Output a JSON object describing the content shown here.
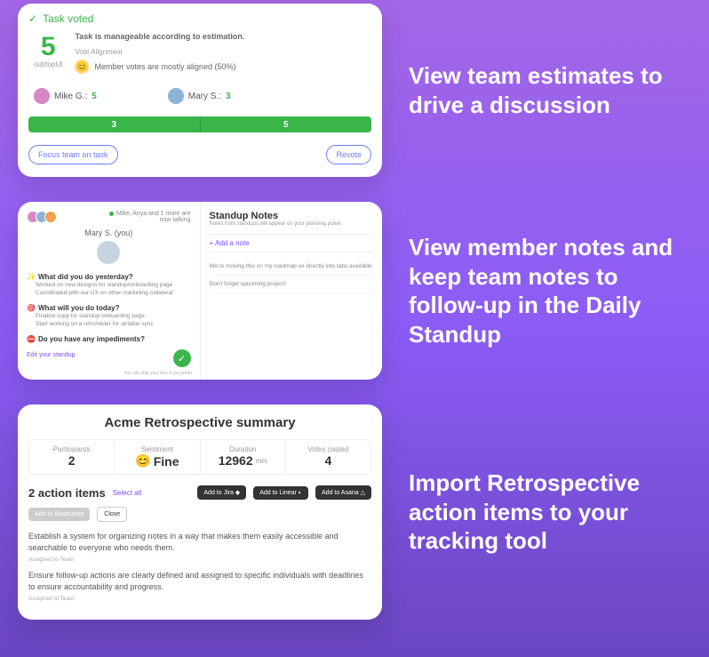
{
  "captions": {
    "c1": "View team estimates to drive a discussion",
    "c2": "View member notes and keep team notes to follow-up in the Daily Standup",
    "c3": "Import Retrospective action items to your tracking tool"
  },
  "card1": {
    "voted": "Task voted",
    "score": "5",
    "scoreLabel": "out/topUt",
    "desc": "Task is manageable according to estimation.",
    "alignLabel": "Vote Alignment",
    "alignText": "Member votes are mostly aligned (50%)",
    "voter1": "Mike G.:",
    "voter1Score": "5",
    "voter2": "Mary S.:",
    "voter2Score": "3",
    "dist1": "3",
    "dist2": "5",
    "focusBtn": "Focus team on task",
    "revoteBtn": "Revote"
  },
  "card2": {
    "status1": "Mike, Anya and 1 more are",
    "status2": "now talking",
    "memberName": "Mary S. (you)",
    "q1": "What did you do yesterday?",
    "q1sub1": "Worked on new designs for standup/onboarding page",
    "q1sub2": "Coordinated with our UX on other marketing collateral",
    "q2": "What will you do today?",
    "q2sub1": "Finalize copy for standup onboarding page",
    "q2sub2": "Start working on a retro/wider for airtable sync",
    "q3": "Do you have any impediments?",
    "editLink": "Edit your standup",
    "footerText": "You can skip your turn if you prefer",
    "notesTitle": "Standup Notes",
    "notesSub": "Notes from standups will appear on your planning poker.",
    "addNote": "+ Add a note",
    "note1": "We're moving this on my roadmap so directly into tabs available",
    "note2": "Don't forget upcoming project!"
  },
  "card3": {
    "title": "Acme Retrospective summary",
    "stat1Label": "Participants",
    "stat1Val": "2",
    "stat2Label": "Sentiment",
    "stat2Val": "Fine",
    "stat3Label": "Duration",
    "stat3Val": "12962",
    "stat3Unit": "min",
    "stat4Label": "Votes casted",
    "stat4Val": "4",
    "actionsTitle": "2 action items",
    "selectAll": "Select all",
    "btnJira": "Add to Jira ◆",
    "btnLinear": "Add to Linear ◐",
    "btnAsana": "Add to Asana △",
    "btnBasecamp": "Add to Basecamp",
    "btnClose": "Close",
    "item1": "Establish a system for organizing notes in a way that makes them easily accessible and searchable to everyone who needs them.",
    "assigned1": "Assigned to Team",
    "item2": "Ensure follow-up actions are clearly defined and assigned to specific individuals with deadlines to ensure accountability and progress.",
    "assigned2": "Assigned to Team"
  }
}
